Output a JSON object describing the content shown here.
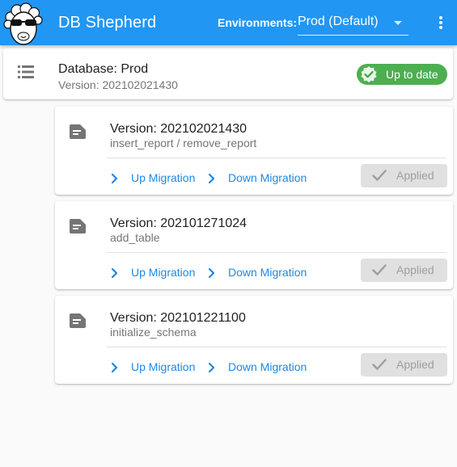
{
  "app": {
    "title": "DB Shepherd",
    "environments_label": "Environments:",
    "environment_selected": "Prod (Default)",
    "accent_color": "#2196f3"
  },
  "database": {
    "title": "Database: Prod",
    "version": "Version: 202102021430",
    "status": "Up to date",
    "status_color": "#4caf50"
  },
  "migrations": [
    {
      "version": "Version: 202102021430",
      "description": "insert_report / remove_report",
      "up_label": "Up Migration",
      "down_label": "Down Migration",
      "status": "Applied"
    },
    {
      "version": "Version: 202101271024",
      "description": "add_table",
      "up_label": "Up Migration",
      "down_label": "Down Migration",
      "status": "Applied"
    },
    {
      "version": "Version: 202101221100",
      "description": "initialize_schema",
      "up_label": "Up Migration",
      "down_label": "Down Migration",
      "status": "Applied"
    }
  ],
  "icons": {
    "logo": "sheep-logo",
    "menu": "more-vert-icon",
    "database": "storage-icon",
    "status": "check-badge-icon",
    "migration": "note-icon",
    "expand": "chevron-right-icon",
    "applied": "check-icon"
  }
}
